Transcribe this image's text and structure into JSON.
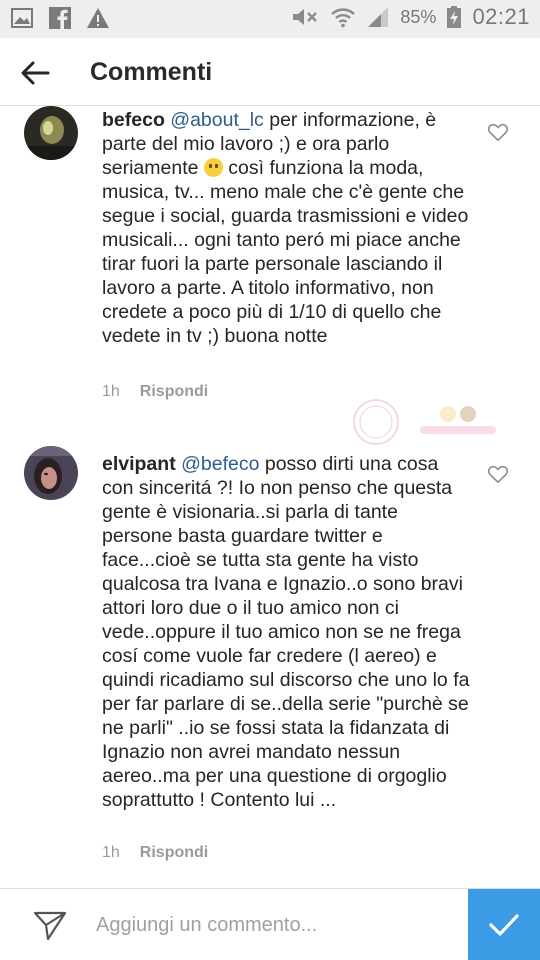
{
  "status_bar": {
    "battery_pct": "85%",
    "time": "02:21",
    "left_icons": [
      "image-icon",
      "facebook-icon",
      "warning-icon"
    ],
    "right_icons": [
      "mute-icon",
      "wifi-icon",
      "signal-icon",
      "battery-charging-icon"
    ]
  },
  "header": {
    "title": "Commenti"
  },
  "comments": [
    {
      "username": "befeco",
      "mention": "@about_lc",
      "text_1": " per informazione, è parte del mio lavoro ;) e ora parlo seriamente ",
      "emoji": "slightly-smiling-emoji",
      "text_2": " così funziona la moda, musica, tv... meno male che c'è gente che segue i social, guarda trasmissioni e video musicali... ogni tanto peró mi piace anche tirar fuori la parte personale lasciando il lavoro a parte. A titolo informativo, non credete a poco più di 1/10 di quello che vedete in tv ;) buona notte",
      "time": "1h",
      "reply_label": "Rispondi"
    },
    {
      "username": "elvipant",
      "mention": "@befeco",
      "text_1": " posso dirti una cosa con sinceritá ?! Io non penso che questa gente è visionaria..si parla di tante persone basta guardare twitter e face...cioè se tutta sta gente ha visto qualcosa tra Ivana e Ignazio..o sono bravi attori loro due o il tuo amico non ci vede..oppure il tuo amico non se ne frega cosí come vuole far credere (l aereo) e quindi ricadiamo sul discorso che uno lo fa per far parlare di se..della serie \"purchè se ne parli\" ..io se fossi stata la fidanzata di Ignazio non avrei mandato nessun aereo..ma per una questione di orgoglio soprattutto ! Contento lui ...",
      "time": "1h",
      "reply_label": "Rispondi"
    }
  ],
  "composer": {
    "placeholder": "Aggiungi un commento..."
  },
  "colors": {
    "mention": "#2f5e8c",
    "post_button": "#3b9be5",
    "meta_text": "#9a9a9a"
  }
}
